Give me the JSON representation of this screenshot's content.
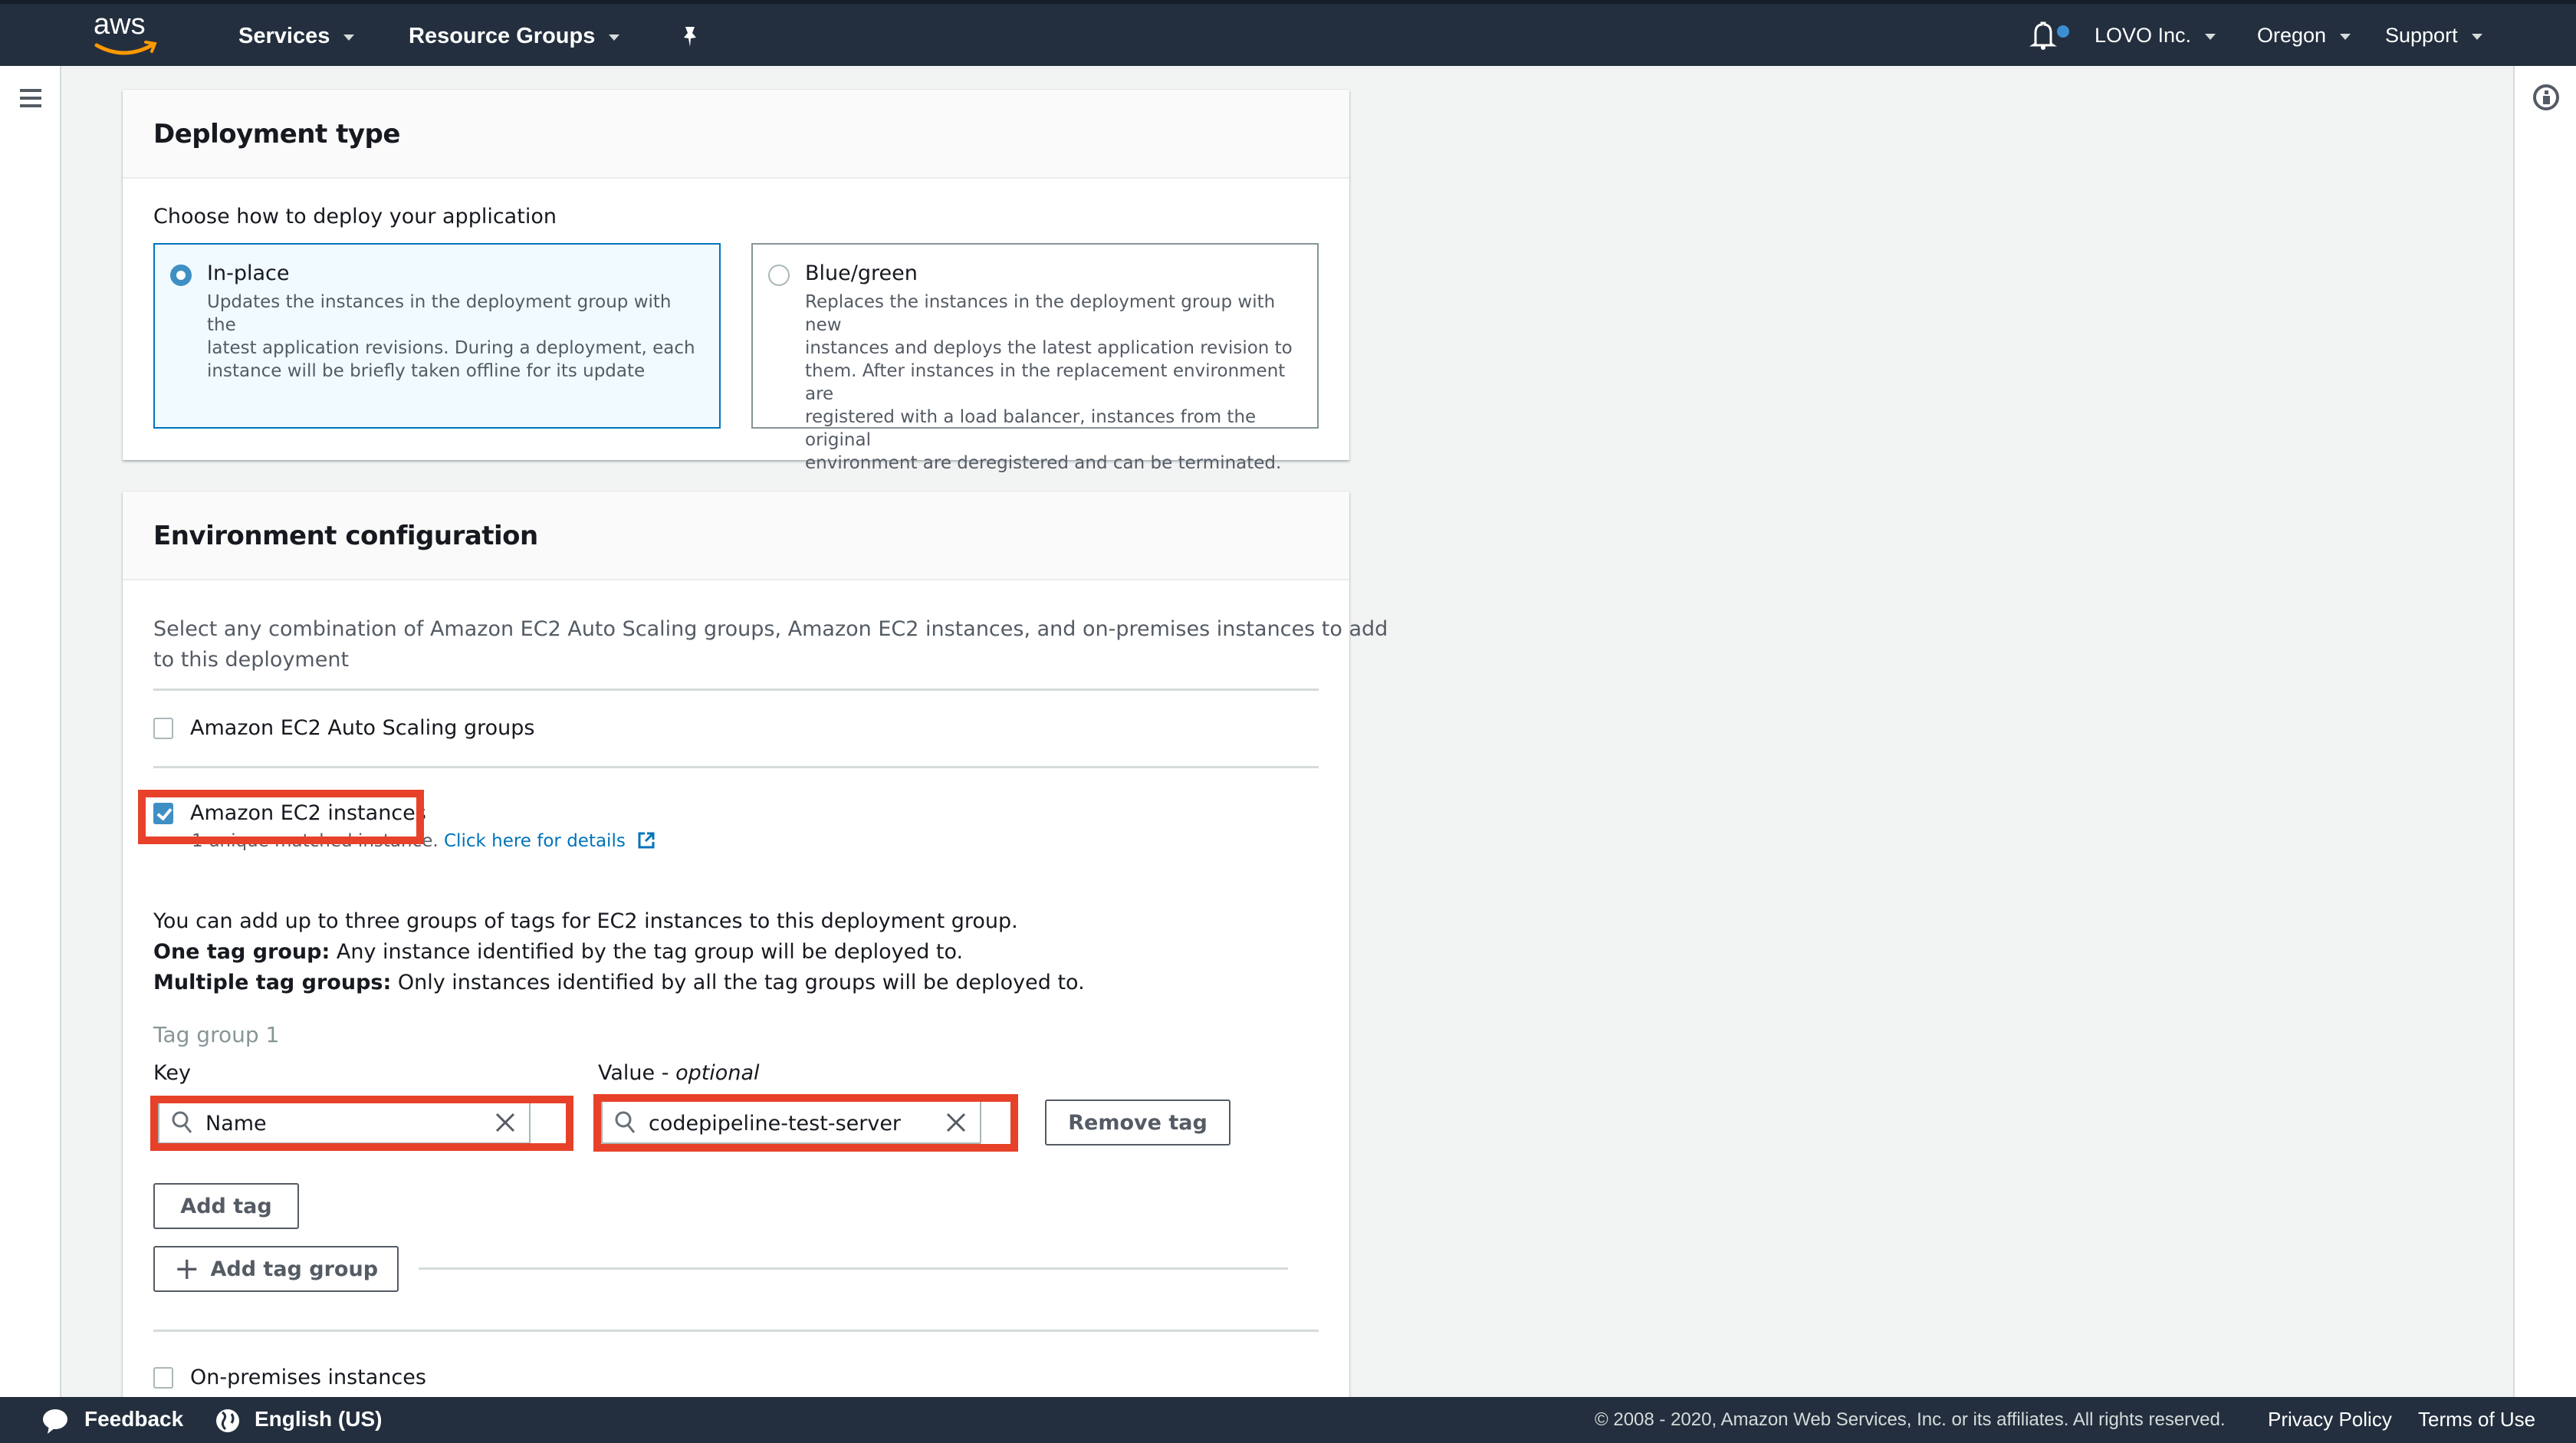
{
  "topbar": {
    "logo": "aws",
    "services": "Services",
    "resource_groups": "Resource Groups",
    "account": "LOVO Inc.",
    "region": "Oregon",
    "support": "Support",
    "notification_dot_color": "#3b8fd0"
  },
  "deployment_type": {
    "title": "Deployment type",
    "prompt": "Choose how to deploy your application",
    "options": [
      {
        "label": "In-place",
        "selected": true,
        "description_lines": [
          "Updates the instances in the deployment group with the",
          "latest application revisions. During a deployment, each",
          "instance will be briefly taken offline for its update"
        ]
      },
      {
        "label": "Blue/green",
        "selected": false,
        "description_lines": [
          "Replaces the instances in the deployment group with new",
          "instances and deploys the latest application revision to",
          "them. After instances in the replacement environment are",
          "registered with a load balancer, instances from the original",
          "environment are deregistered and can be terminated."
        ]
      }
    ]
  },
  "environment": {
    "title": "Environment configuration",
    "description_lines": [
      "Select any combination of Amazon EC2 Auto Scaling groups, Amazon EC2 instances, and on-premises instances to add",
      "to this deployment"
    ],
    "auto_scaling": {
      "label": "Amazon EC2 Auto Scaling groups",
      "checked": false
    },
    "ec2_instances": {
      "label": "Amazon EC2 instances",
      "checked": true,
      "matched_text": "1 unique matched instance.",
      "details_link": "Click here for details"
    },
    "tag_info": {
      "line1": "You can add up to three groups of tags for EC2 instances to this deployment group.",
      "line2_bold": "One tag group:",
      "line2_rest": " Any instance identified by the tag group will be deployed to.",
      "line3_bold": "Multiple tag groups:",
      "line3_rest": " Only instances identified by all the tag groups will be deployed to."
    },
    "tag_group": {
      "title": "Tag group 1",
      "key_label": "Key",
      "value_label": "Value - ",
      "value_label_optional": "optional",
      "key_value": "Name",
      "value_value": "codepipeline-test-server",
      "remove_tag": "Remove tag",
      "add_tag": "Add tag",
      "add_tag_group": "Add tag group"
    },
    "on_premises": {
      "label": "On-premises instances",
      "checked": false
    }
  },
  "footer": {
    "feedback": "Feedback",
    "language": "English (US)",
    "copyright": "© 2008 - 2020, Amazon Web Services, Inc. or its affiliates. All rights reserved.",
    "privacy": "Privacy Policy",
    "terms": "Terms of Use"
  },
  "colors": {
    "header_bg": "#232f3e",
    "accent_blue": "#3f8fc4",
    "highlight_red": "#e8412a",
    "link_blue": "#0073bb"
  }
}
